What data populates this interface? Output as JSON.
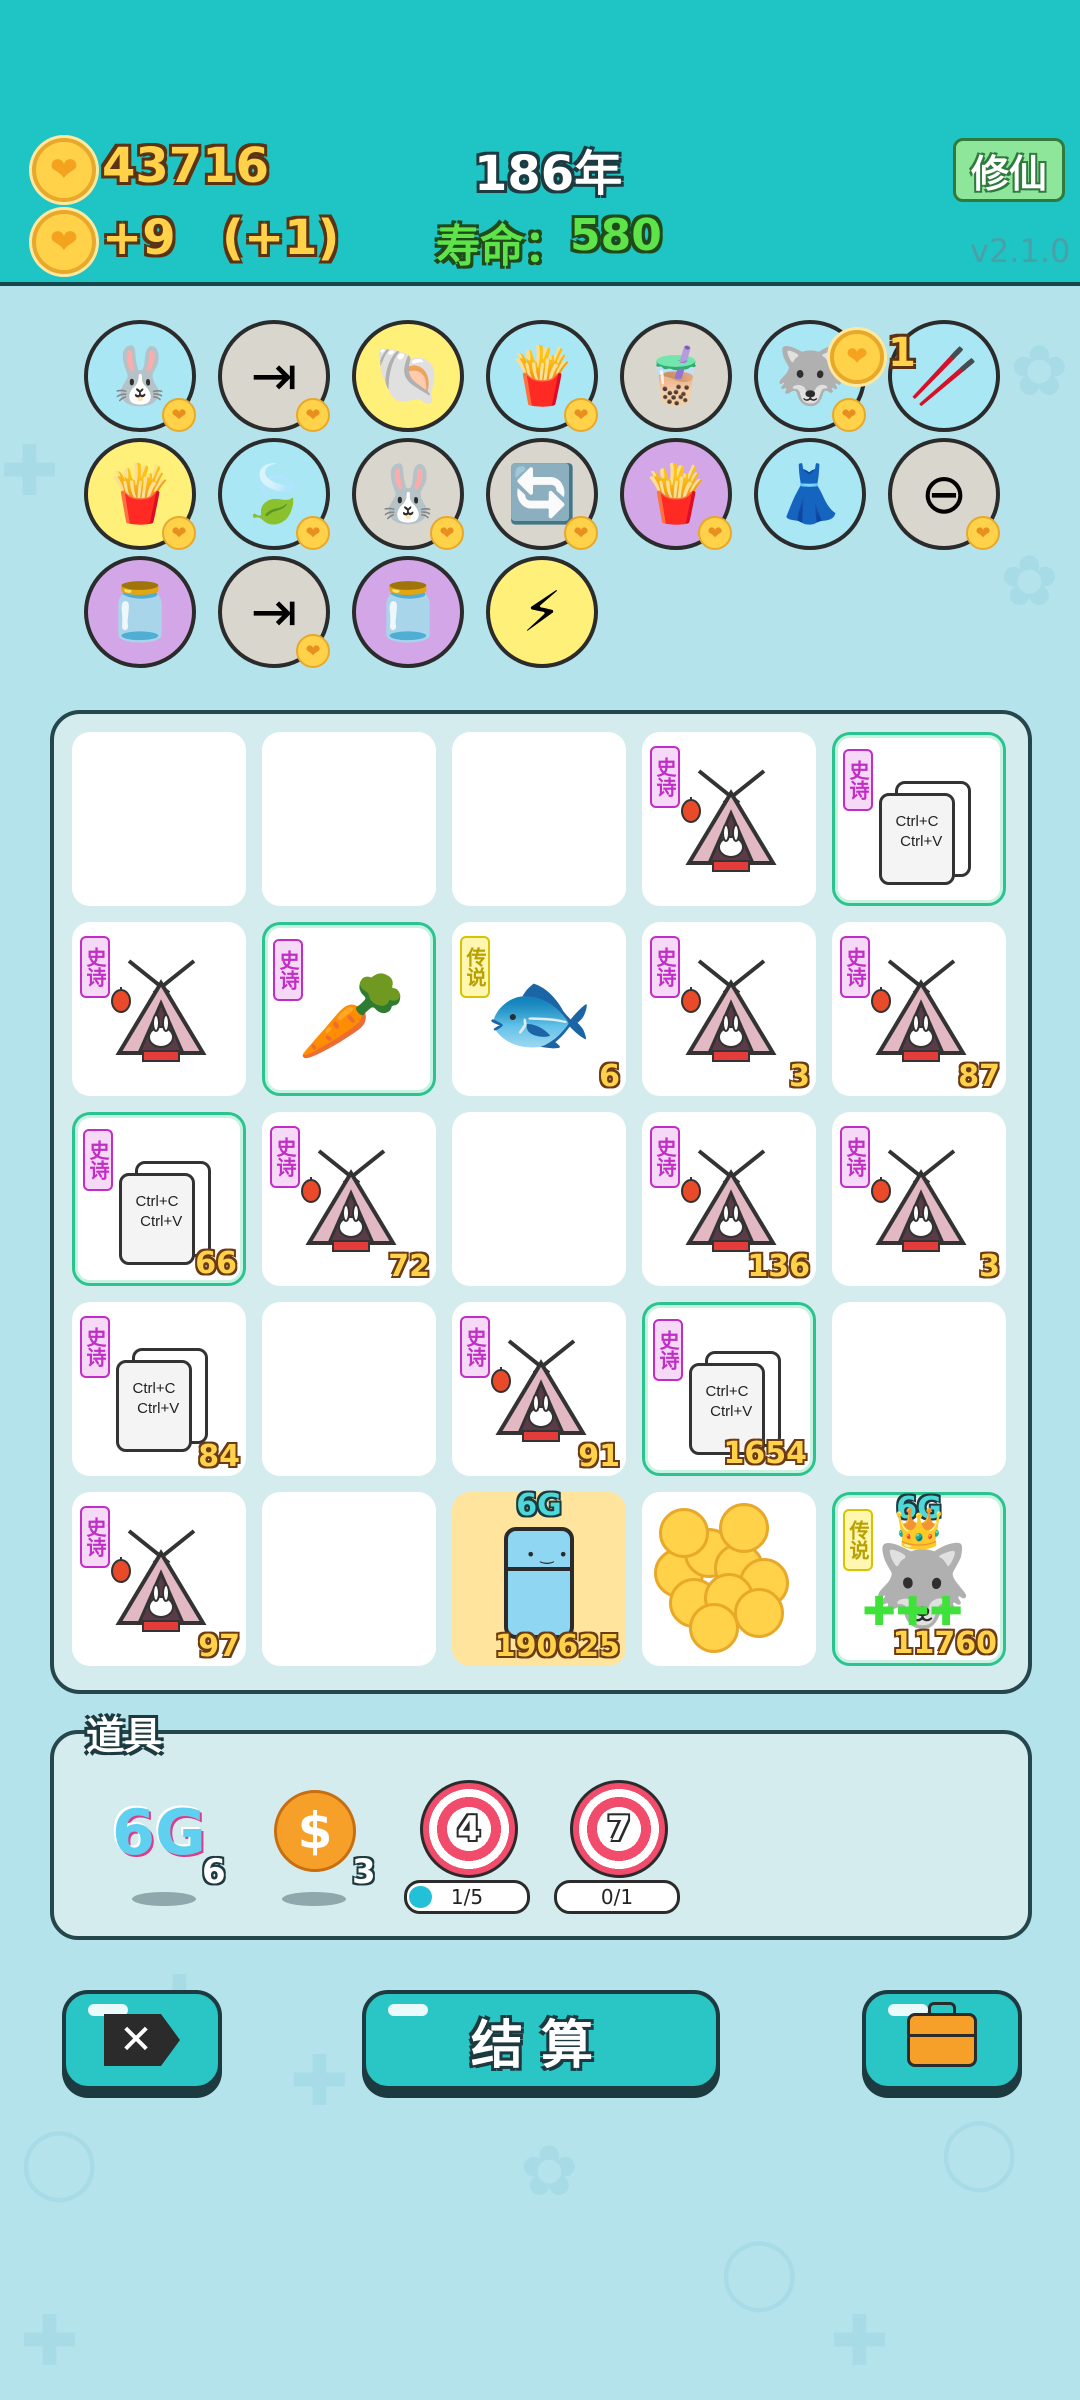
{
  "header": {
    "coins": "43716",
    "income": "+9",
    "bonus": "(+1)",
    "year": "186年",
    "lifespan_label": "寿命：",
    "lifespan": "580",
    "cultivate_button": "修仙",
    "version": "v2.1.0"
  },
  "buffs": {
    "coin_badge_text": "1",
    "items": [
      {
        "icon": "rabbit-icon",
        "glyph": "🐰",
        "bg": "#a9e7f5"
      },
      {
        "icon": "skip-icon",
        "glyph": "⇥",
        "bg": "#d9d6cd"
      },
      {
        "icon": "shell-icon",
        "glyph": "🐚",
        "bg": "#fff07a"
      },
      {
        "icon": "fries-icon",
        "glyph": "🍟",
        "bg": "#a9e7f5"
      },
      {
        "icon": "milk-tea-icon",
        "glyph": "🧋",
        "bg": "#d9d6cd"
      },
      {
        "icon": "husky-icon",
        "glyph": "🐺",
        "bg": "#a9e7f5"
      },
      {
        "icon": "chopsticks-icon",
        "glyph": "🥢",
        "bg": "#a9e7f5"
      },
      {
        "icon": "fries-icon",
        "glyph": "🍟",
        "bg": "#fff07a"
      },
      {
        "icon": "leaf-icon",
        "glyph": "🍃",
        "bg": "#a9e7f5"
      },
      {
        "icon": "rabbit-icon",
        "glyph": "🐰",
        "bg": "#d9d6cd"
      },
      {
        "icon": "refresh-icon",
        "glyph": "🔄",
        "bg": "#d9d6cd"
      },
      {
        "icon": "fries-icon",
        "glyph": "🍟",
        "bg": "#d3a6e8"
      },
      {
        "icon": "skirt-icon",
        "glyph": "👗",
        "bg": "#a9e7f5"
      },
      {
        "icon": "minus-icon",
        "glyph": "⊖",
        "bg": "#d9d6cd"
      },
      {
        "icon": "jar-icon",
        "glyph": "🫙",
        "bg": "#d3a6e8"
      },
      {
        "icon": "skip-icon",
        "glyph": "⇥",
        "bg": "#d9d6cd"
      },
      {
        "icon": "jar-icon",
        "glyph": "🫙",
        "bg": "#d3a6e8"
      },
      {
        "icon": "lightning-icon",
        "glyph": "⚡",
        "bg": "#fff07a"
      }
    ]
  },
  "board": {
    "tiles": [
      {
        "item": "",
        "tag": "",
        "count": ""
      },
      {
        "item": "",
        "tag": "",
        "count": ""
      },
      {
        "item": "",
        "tag": "",
        "count": ""
      },
      {
        "item": "tent",
        "tag": "史诗",
        "count": ""
      },
      {
        "item": "copy",
        "tag": "史诗",
        "count": "",
        "glow": true
      },
      {
        "item": "tent",
        "tag": "史诗",
        "count": ""
      },
      {
        "item": "carrot",
        "tag": "史诗",
        "count": "",
        "glow": true
      },
      {
        "item": "koi",
        "tag": "传说",
        "count": "6"
      },
      {
        "item": "tent",
        "tag": "史诗",
        "count": "3"
      },
      {
        "item": "tent",
        "tag": "史诗",
        "count": "87"
      },
      {
        "item": "copy",
        "tag": "史诗",
        "count": "66",
        "glow": true
      },
      {
        "item": "tent",
        "tag": "史诗",
        "count": "72"
      },
      {
        "item": "",
        "tag": "",
        "count": ""
      },
      {
        "item": "tent",
        "tag": "史诗",
        "count": "136"
      },
      {
        "item": "tent",
        "tag": "史诗",
        "count": "3"
      },
      {
        "item": "copy",
        "tag": "史诗",
        "count": "84"
      },
      {
        "item": "",
        "tag": "",
        "count": ""
      },
      {
        "item": "tent",
        "tag": "史诗",
        "count": "91"
      },
      {
        "item": "copy",
        "tag": "史诗",
        "count": "1654",
        "glow": true
      },
      {
        "item": "",
        "tag": "",
        "count": ""
      },
      {
        "item": "tent",
        "tag": "史诗",
        "count": "97"
      },
      {
        "item": "",
        "tag": "",
        "count": ""
      },
      {
        "item": "fridge",
        "tag": "",
        "count": "190625",
        "top": "6G",
        "gold": true
      },
      {
        "item": "coins",
        "tag": "",
        "count": ""
      },
      {
        "item": "husky",
        "tag": "传说",
        "count": "11760",
        "top": "6G",
        "glow": true
      }
    ],
    "copy_text_1": "Ctrl+C",
    "copy_text_2": "Ctrl+V"
  },
  "props": {
    "title": "道具",
    "g6_label": "6G",
    "g6_count": "6",
    "dollar_count": "3",
    "target1_number": "4",
    "target1_progress": "1/5",
    "target1_fraction": 0.2,
    "target2_number": "7",
    "target2_progress": "0/1",
    "target2_fraction": 0
  },
  "bottom": {
    "settle_label": "结算"
  },
  "colors": {
    "header": "#1fc4c4",
    "background": "#b4e3ec",
    "coin": "#ffd24a",
    "button": "#2ac6c6"
  }
}
